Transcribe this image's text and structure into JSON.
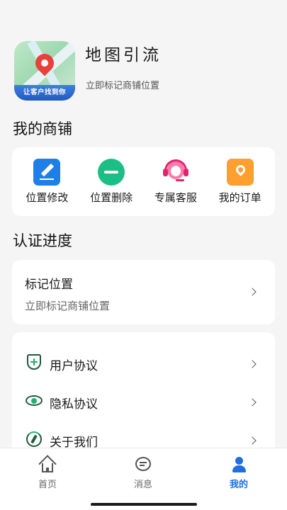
{
  "profile": {
    "app_name": "地图引流",
    "subtitle": "立即标记商铺位置",
    "logo_text": "让客户找到你"
  },
  "shop": {
    "title": "我的商铺",
    "items": [
      {
        "label": "位置修改",
        "icon": "edit-icon",
        "color": "#1f7fe8"
      },
      {
        "label": "位置删除",
        "icon": "minus-circle-icon",
        "color": "#1bbf86"
      },
      {
        "label": "专属客服",
        "icon": "customer-service-icon",
        "color": "#e0246f"
      },
      {
        "label": "我的订单",
        "icon": "location-pin-icon",
        "color": "#ff9f2e"
      }
    ]
  },
  "certification": {
    "title": "认证进度",
    "item_title": "标记位置",
    "item_subtitle": "立即标记商铺位置"
  },
  "settings": {
    "items": [
      {
        "label": "用户协议",
        "icon": "shield-plus-icon"
      },
      {
        "label": "隐私协议",
        "icon": "eye-icon"
      },
      {
        "label": "关于我们",
        "icon": "compass-icon"
      }
    ]
  },
  "tabbar": {
    "tabs": [
      {
        "label": "首页",
        "icon": "home-icon",
        "active": false
      },
      {
        "label": "消息",
        "icon": "message-icon",
        "active": false
      },
      {
        "label": "我的",
        "icon": "user-icon",
        "active": true
      }
    ],
    "active_color": "#1f6fe0"
  }
}
